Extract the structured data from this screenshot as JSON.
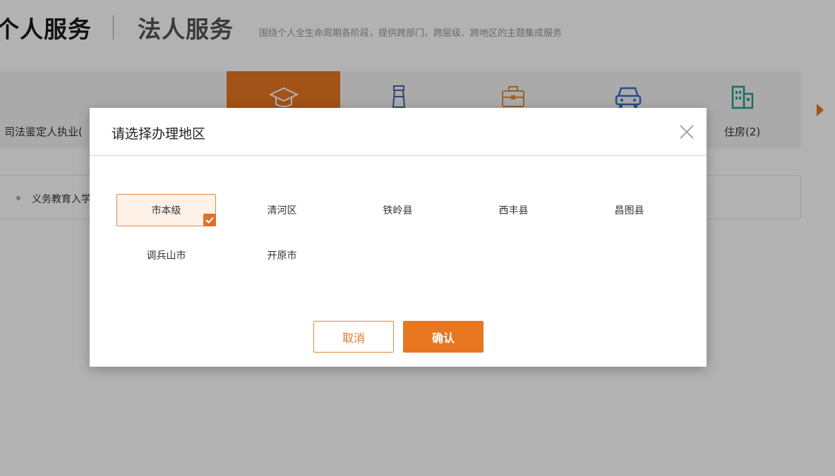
{
  "header": {
    "tab_personal": "个人服务",
    "tab_legal": "法人服务",
    "description": "围绕个人全生命周期各阶段，提供跨部门、跨层级、跨地区的主题集成服务"
  },
  "topics": {
    "left_label": "司法鉴定人执业(",
    "housing_label": "住房(2)",
    "icons": [
      "graduation-cap",
      "bottle",
      "briefcase",
      "car",
      "building"
    ]
  },
  "list": {
    "first_item": "义务教育入学"
  },
  "modal": {
    "title": "请选择办理地区",
    "regions": [
      "市本级",
      "清河区",
      "铁岭县",
      "西丰县",
      "昌图县",
      "调兵山市",
      "开原市"
    ],
    "selected_region": "市本级",
    "cancel_label": "取消",
    "confirm_label": "确认"
  },
  "colors": {
    "accent": "#e87722",
    "selected_bg": "#fdf1e8",
    "housing_icon": "#2a9d8f",
    "car_icon": "#3a6fc4",
    "bottle_icon": "#4a5fa8",
    "briefcase_icon": "#e08a3a"
  }
}
